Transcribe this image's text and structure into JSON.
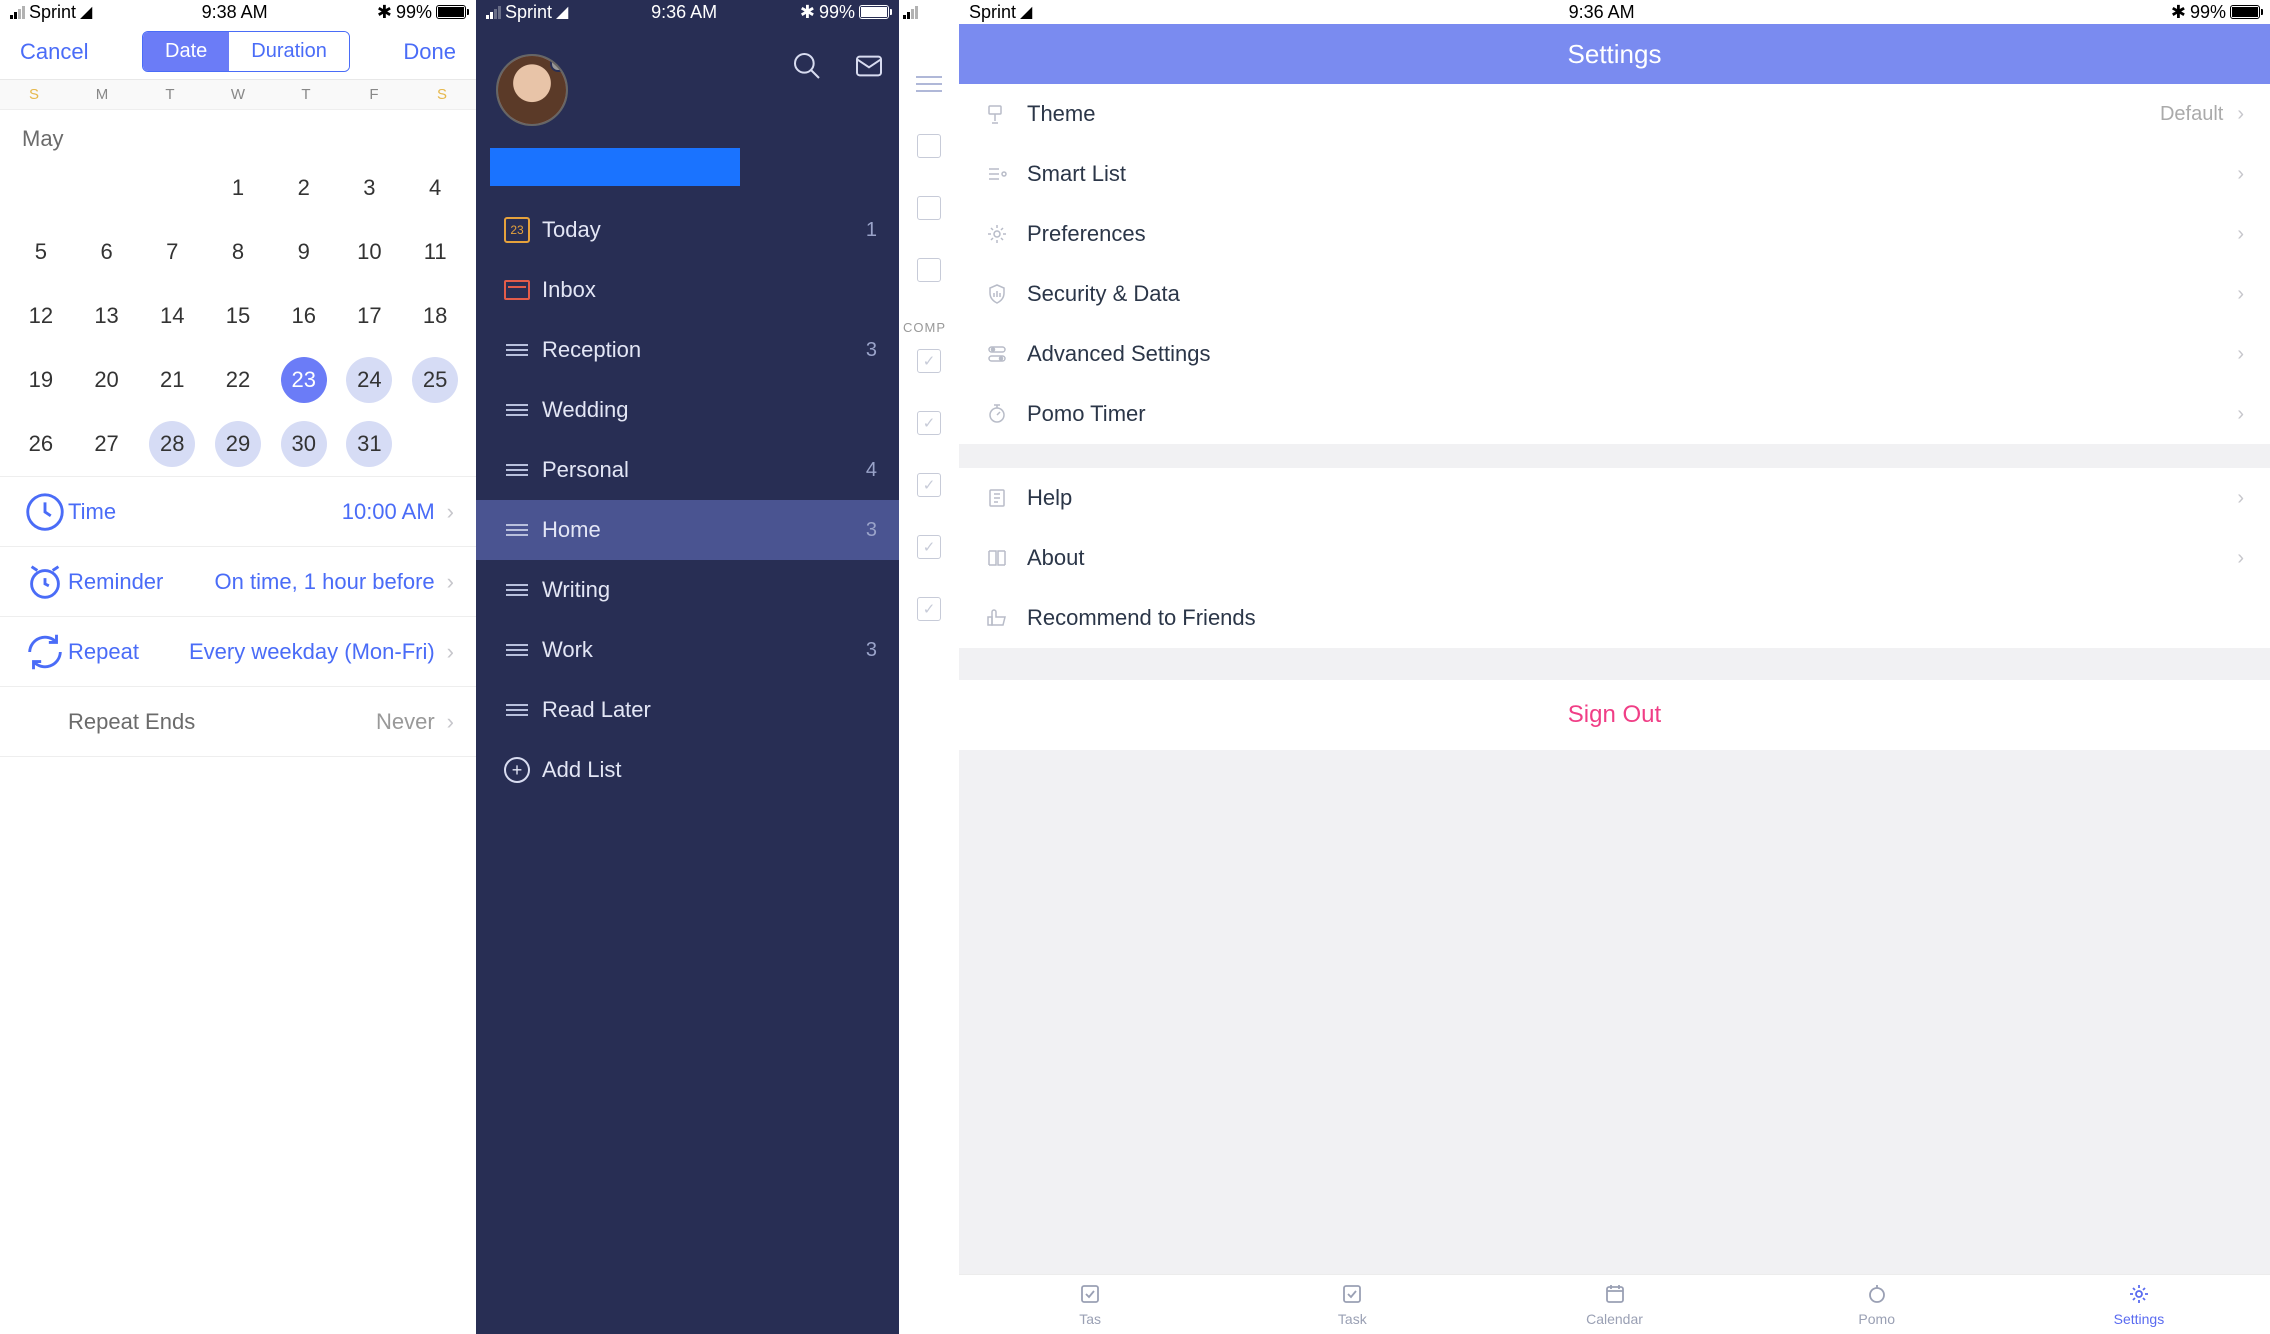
{
  "screen1": {
    "status": {
      "carrier": "Sprint",
      "time": "9:38 AM",
      "battery": "99%"
    },
    "toolbar": {
      "cancel": "Cancel",
      "done": "Done",
      "date": "Date",
      "duration": "Duration"
    },
    "weekdays": [
      "S",
      "M",
      "T",
      "W",
      "T",
      "F",
      "S"
    ],
    "month": "May",
    "cal": {
      "days": [
        "",
        "1",
        "2",
        "3",
        "4",
        "5",
        "6",
        "7",
        "8",
        "9",
        "10",
        "11",
        "12",
        "13",
        "14",
        "15",
        "16",
        "17",
        "18",
        "19",
        "20",
        "21",
        "22",
        "23",
        "24",
        "25",
        "26",
        "27",
        "28",
        "29",
        "30",
        "31"
      ],
      "selected": "23",
      "shaded": [
        "24",
        "25",
        "28",
        "29",
        "30",
        "31"
      ]
    },
    "rows": {
      "time": {
        "label": "Time",
        "value": "10:00 AM"
      },
      "reminder": {
        "label": "Reminder",
        "value": "On time, 1 hour before"
      },
      "repeat": {
        "label": "Repeat",
        "value": "Every weekday (Mon-Fri)"
      },
      "ends": {
        "label": "Repeat Ends",
        "value": "Never"
      }
    }
  },
  "screen2": {
    "status": {
      "carrier": "Sprint",
      "time": "9:36 AM",
      "battery": "99%"
    },
    "todaynum": "23",
    "items": [
      {
        "name": "today",
        "label": "Today",
        "count": "1"
      },
      {
        "name": "inbox",
        "label": "Inbox",
        "count": ""
      },
      {
        "name": "reception",
        "label": "Reception",
        "count": "3"
      },
      {
        "name": "wedding",
        "label": "Wedding",
        "count": ""
      },
      {
        "name": "personal",
        "label": "Personal",
        "count": "4"
      },
      {
        "name": "home",
        "label": "Home",
        "count": "3",
        "active": true
      },
      {
        "name": "writing",
        "label": "Writing",
        "count": ""
      },
      {
        "name": "work",
        "label": "Work",
        "count": "3"
      },
      {
        "name": "readlater",
        "label": "Read Later",
        "count": ""
      }
    ],
    "addlist": "Add List"
  },
  "screen3": {
    "status": {
      "carrier": "Sprint",
      "time": "9:36 AM",
      "battery": "99%"
    },
    "title": "Settings",
    "left_section": "COMP",
    "tabs": [
      {
        "label": "Tas"
      },
      {
        "label": "Task"
      },
      {
        "label": "Calendar"
      },
      {
        "label": "Pomo"
      },
      {
        "label": "Settings",
        "active": true
      }
    ],
    "group1": [
      {
        "name": "theme",
        "label": "Theme",
        "value": "Default"
      },
      {
        "name": "smartlist",
        "label": "Smart List",
        "value": ""
      },
      {
        "name": "preferences",
        "label": "Preferences",
        "value": ""
      },
      {
        "name": "security",
        "label": "Security & Data",
        "value": ""
      },
      {
        "name": "advanced",
        "label": "Advanced Settings",
        "value": ""
      },
      {
        "name": "pomo",
        "label": "Pomo Timer",
        "value": ""
      }
    ],
    "group2": [
      {
        "name": "help",
        "label": "Help"
      },
      {
        "name": "about",
        "label": "About"
      },
      {
        "name": "recommend",
        "label": "Recommend to Friends",
        "nochev": true
      }
    ],
    "signout": "Sign Out"
  }
}
